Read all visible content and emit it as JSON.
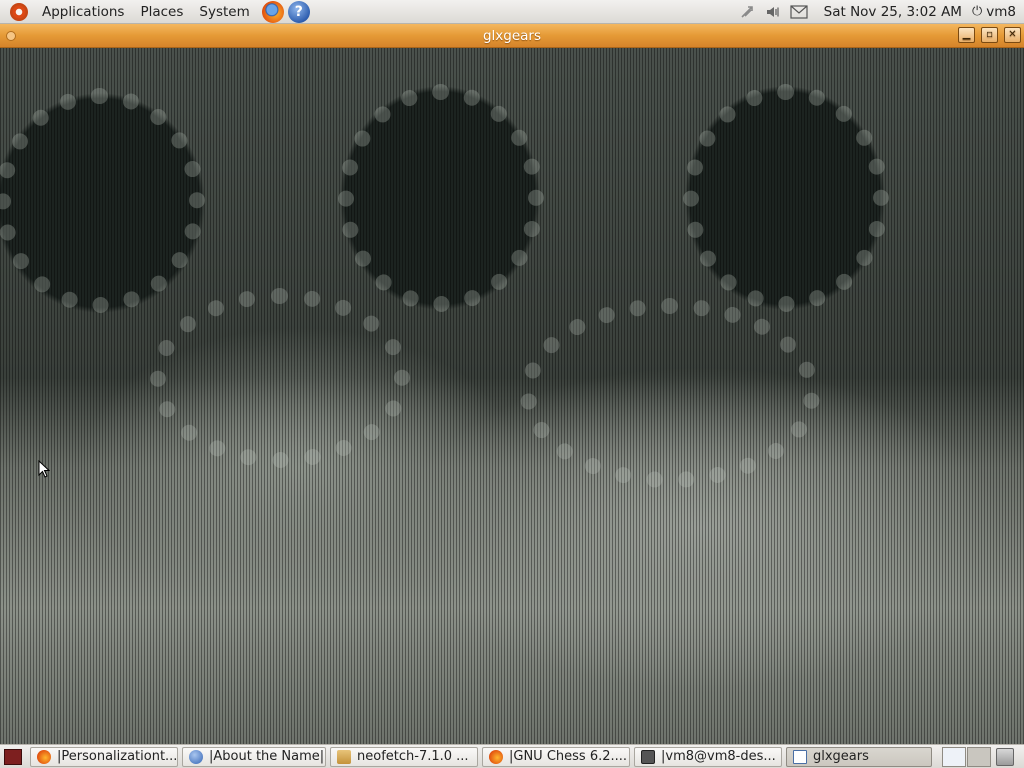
{
  "top_panel": {
    "menus": [
      "Applications",
      "Places",
      "System"
    ],
    "launchers": [
      "firefox-icon",
      "help-icon"
    ],
    "tray_icons": [
      "network-icon",
      "volume-icon",
      "mail-icon"
    ],
    "clock": "Sat Nov 25,  3:02 AM",
    "user": "vm8"
  },
  "window": {
    "title": "glxgears",
    "buttons": [
      "minimize",
      "maximize",
      "close"
    ]
  },
  "taskbar": {
    "tasks": [
      {
        "label": "|Personalizationt...",
        "icon": "firefox-icon",
        "active": false
      },
      {
        "label": "|About the Name|",
        "icon": "help-icon",
        "active": false
      },
      {
        "label": "neofetch-7.1.0 ...",
        "icon": "folder-icon",
        "active": false
      },
      {
        "label": "|GNU Chess 6.2....",
        "icon": "firefox-icon",
        "active": false
      },
      {
        "label": "|vm8@vm8-des...",
        "icon": "terminal-icon",
        "active": false
      },
      {
        "label": "glxgears",
        "icon": "window-icon",
        "active": true
      }
    ]
  },
  "colors": {
    "titlebar_accent": "#e59a36",
    "panel_bg": "#dcdad5"
  }
}
